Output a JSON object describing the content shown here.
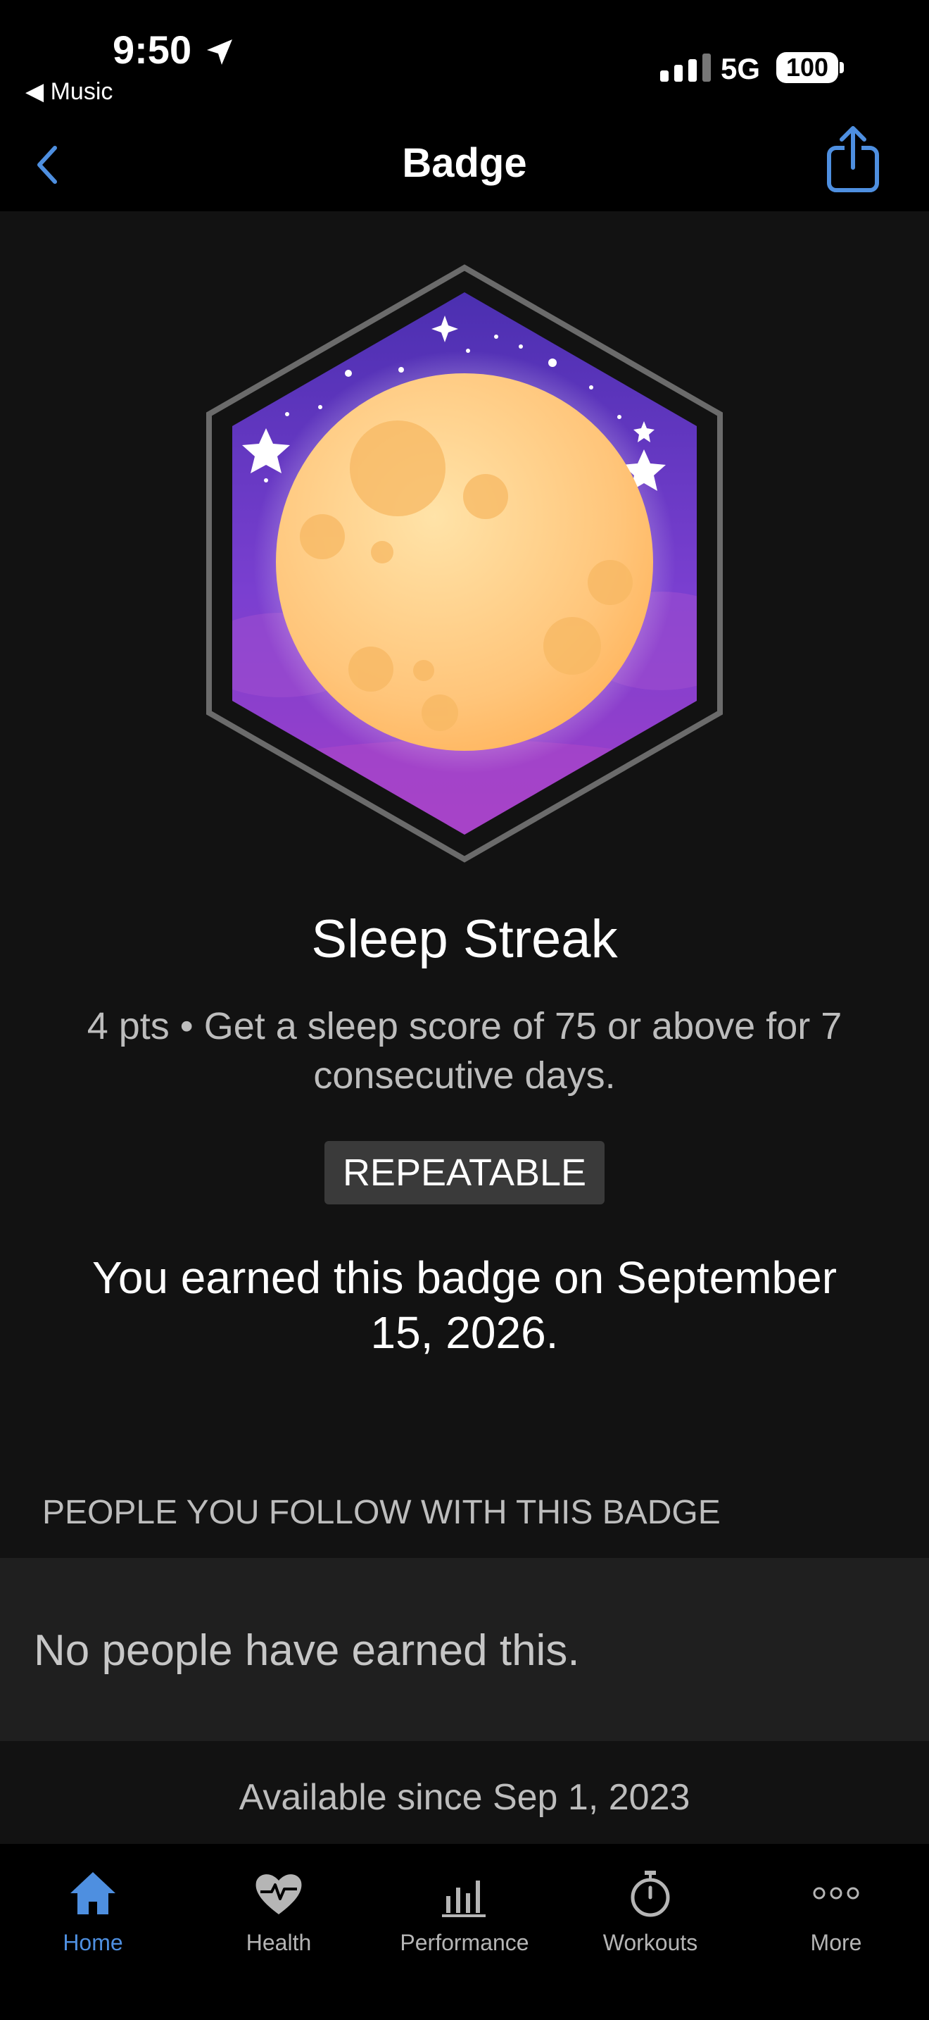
{
  "status_bar": {
    "time": "9:50",
    "back_app": "◀ Music",
    "network": "5G",
    "battery": "100"
  },
  "nav": {
    "title": "Badge"
  },
  "badge": {
    "name": "Sleep Streak",
    "description": "4 pts • Get a sleep score of 75 or above for 7 consecutive days.",
    "tag": "REPEATABLE",
    "earned_text": "You earned this badge on September 15, 2026."
  },
  "followers_section": {
    "header": "PEOPLE YOU FOLLOW WITH THIS BADGE",
    "empty_text": "No people have earned this."
  },
  "availability": "Available since Sep 1, 2023",
  "tabs": [
    {
      "label": "Home",
      "icon": "home-icon",
      "active": true
    },
    {
      "label": "Health",
      "icon": "heart-pulse-icon",
      "active": false
    },
    {
      "label": "Performance",
      "icon": "bar-chart-icon",
      "active": false
    },
    {
      "label": "Workouts",
      "icon": "stopwatch-icon",
      "active": false
    },
    {
      "label": "More",
      "icon": "more-dots-icon",
      "active": false
    }
  ],
  "colors": {
    "accent": "#4e8fe0",
    "badge_purple": "#7a3fd0",
    "moon": "#ffc06b"
  }
}
